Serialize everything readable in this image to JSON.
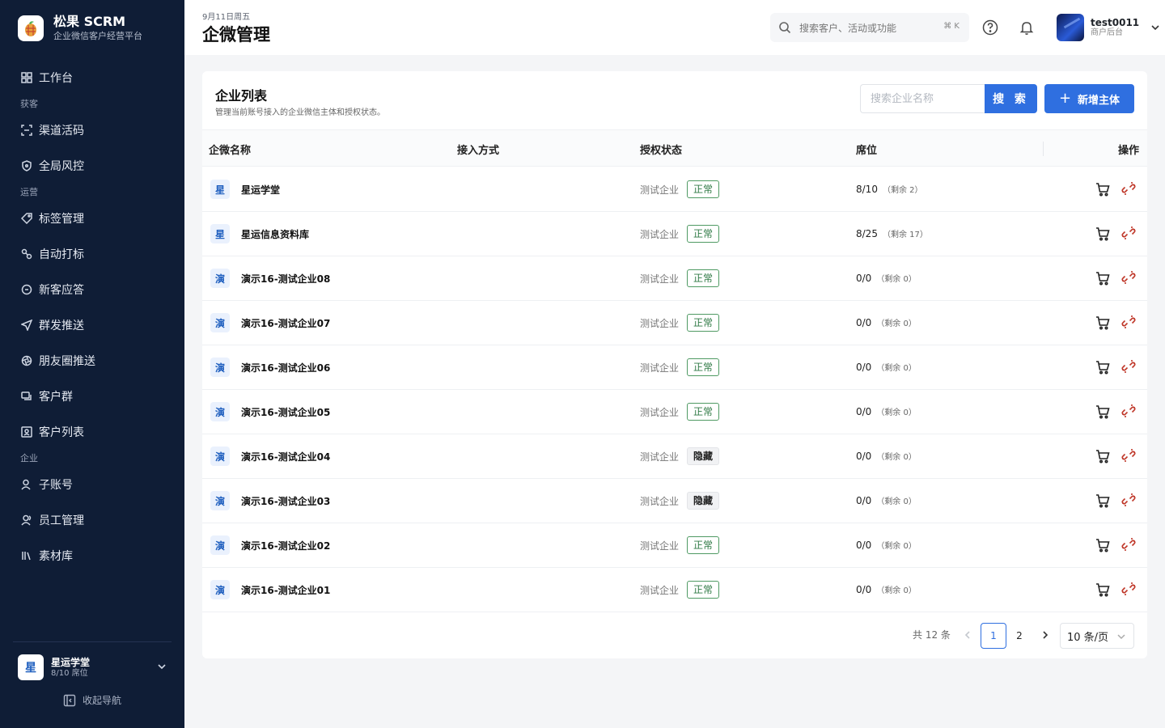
{
  "brand": {
    "title": "松果 SCRM",
    "subtitle": "企业微信客户经营平台"
  },
  "nav": {
    "workbench": "工作台",
    "group_acquire": "获客",
    "channel_code": "渠道活码",
    "risk_control": "全局风控",
    "group_operate": "运营",
    "tag_manage": "标签管理",
    "auto_tag": "自动打标",
    "welcome_reply": "新客应答",
    "group_push": "群发推送",
    "moments_push": "朋友圈推送",
    "customer_group": "客户群",
    "customer_list": "客户列表",
    "group_enterprise": "企业",
    "sub_account": "子账号",
    "staff_manage": "员工管理",
    "material_lib": "素材库"
  },
  "tenant": {
    "avatar": "星",
    "name": "星运学堂",
    "seats": "8/10 席位"
  },
  "collapse_label": "收起导航",
  "header": {
    "date": "9月11日周五",
    "title": "企微管理",
    "search_placeholder": "搜索客户、活动或功能",
    "search_shortcut": "⌘ K",
    "user_name": "test0011",
    "user_role": "商户后台"
  },
  "card": {
    "title": "企业列表",
    "subtitle": "管理当前账号接入的企业微信主体和授权状态。",
    "search_placeholder": "搜索企业名称",
    "search_button": "搜 索",
    "add_button_icon": "+",
    "add_button": "新增主体"
  },
  "table": {
    "columns": {
      "name": "企微名称",
      "access": "接入方式",
      "auth": "授权状态",
      "seat": "席位",
      "ops": "操作"
    },
    "rows": [
      {
        "avatar": "星",
        "name": "星运学堂",
        "type": "测试企业",
        "status": "正常",
        "seat": "8/10",
        "remain": "（剩余 2）"
      },
      {
        "avatar": "星",
        "name": "星运信息资料库",
        "type": "测试企业",
        "status": "正常",
        "seat": "8/25",
        "remain": "（剩余 17）"
      },
      {
        "avatar": "演",
        "name": "演示16-测试企业08",
        "type": "测试企业",
        "status": "正常",
        "seat": "0/0",
        "remain": "（剩余 0）"
      },
      {
        "avatar": "演",
        "name": "演示16-测试企业07",
        "type": "测试企业",
        "status": "正常",
        "seat": "0/0",
        "remain": "（剩余 0）"
      },
      {
        "avatar": "演",
        "name": "演示16-测试企业06",
        "type": "测试企业",
        "status": "正常",
        "seat": "0/0",
        "remain": "（剩余 0）"
      },
      {
        "avatar": "演",
        "name": "演示16-测试企业05",
        "type": "测试企业",
        "status": "正常",
        "seat": "0/0",
        "remain": "（剩余 0）"
      },
      {
        "avatar": "演",
        "name": "演示16-测试企业04",
        "type": "测试企业",
        "status": "隐藏",
        "seat": "0/0",
        "remain": "（剩余 0）"
      },
      {
        "avatar": "演",
        "name": "演示16-测试企业03",
        "type": "测试企业",
        "status": "隐藏",
        "seat": "0/0",
        "remain": "（剩余 0）"
      },
      {
        "avatar": "演",
        "name": "演示16-测试企业02",
        "type": "测试企业",
        "status": "正常",
        "seat": "0/0",
        "remain": "（剩余 0）"
      },
      {
        "avatar": "演",
        "name": "演示16-测试企业01",
        "type": "测试企业",
        "status": "正常",
        "seat": "0/0",
        "remain": "（剩余 0）"
      }
    ]
  },
  "pagination": {
    "total": "共 12 条",
    "page1": "1",
    "page2": "2",
    "page_size": "10 条/页"
  },
  "colors": {
    "sidebar_bg": "#0f1d36",
    "primary": "#2f6fe0",
    "status_normal": "#2f7a45",
    "unlink": "#c0392b"
  }
}
